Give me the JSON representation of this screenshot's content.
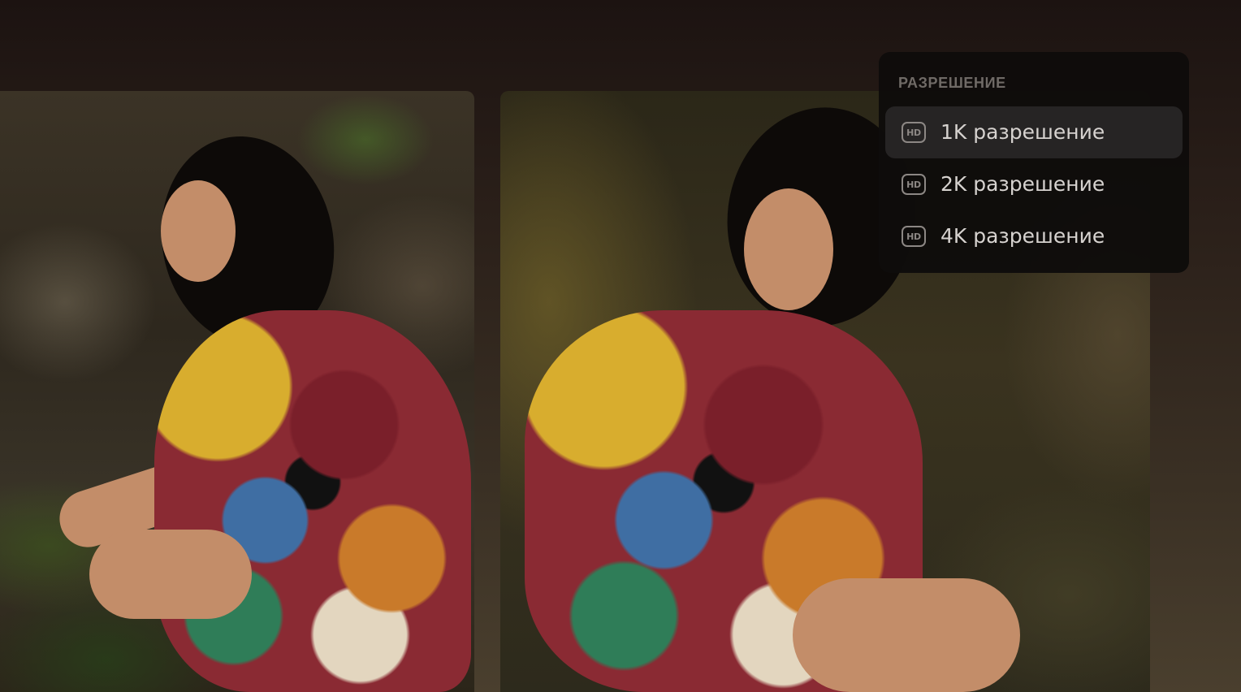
{
  "resolution_menu": {
    "header": "РАЗРЕШЕНИЕ",
    "selected_index": 0,
    "items": [
      {
        "icon": "hd-icon",
        "icon_text": "HD",
        "label": "1K разрешение"
      },
      {
        "icon": "hd-icon",
        "icon_text": "HD",
        "label": "2K разрешение"
      },
      {
        "icon": "hd-icon",
        "icon_text": "HD",
        "label": "4K разрешение"
      }
    ]
  },
  "images": [
    {
      "name": "generated-image-1"
    },
    {
      "name": "generated-image-2"
    }
  ],
  "colors": {
    "background_top": "#1c1311",
    "menu_background": "#0e0c0b",
    "menu_selected": "#262424",
    "menu_header": "#6f6a66",
    "menu_text": "#d6d2cf"
  }
}
